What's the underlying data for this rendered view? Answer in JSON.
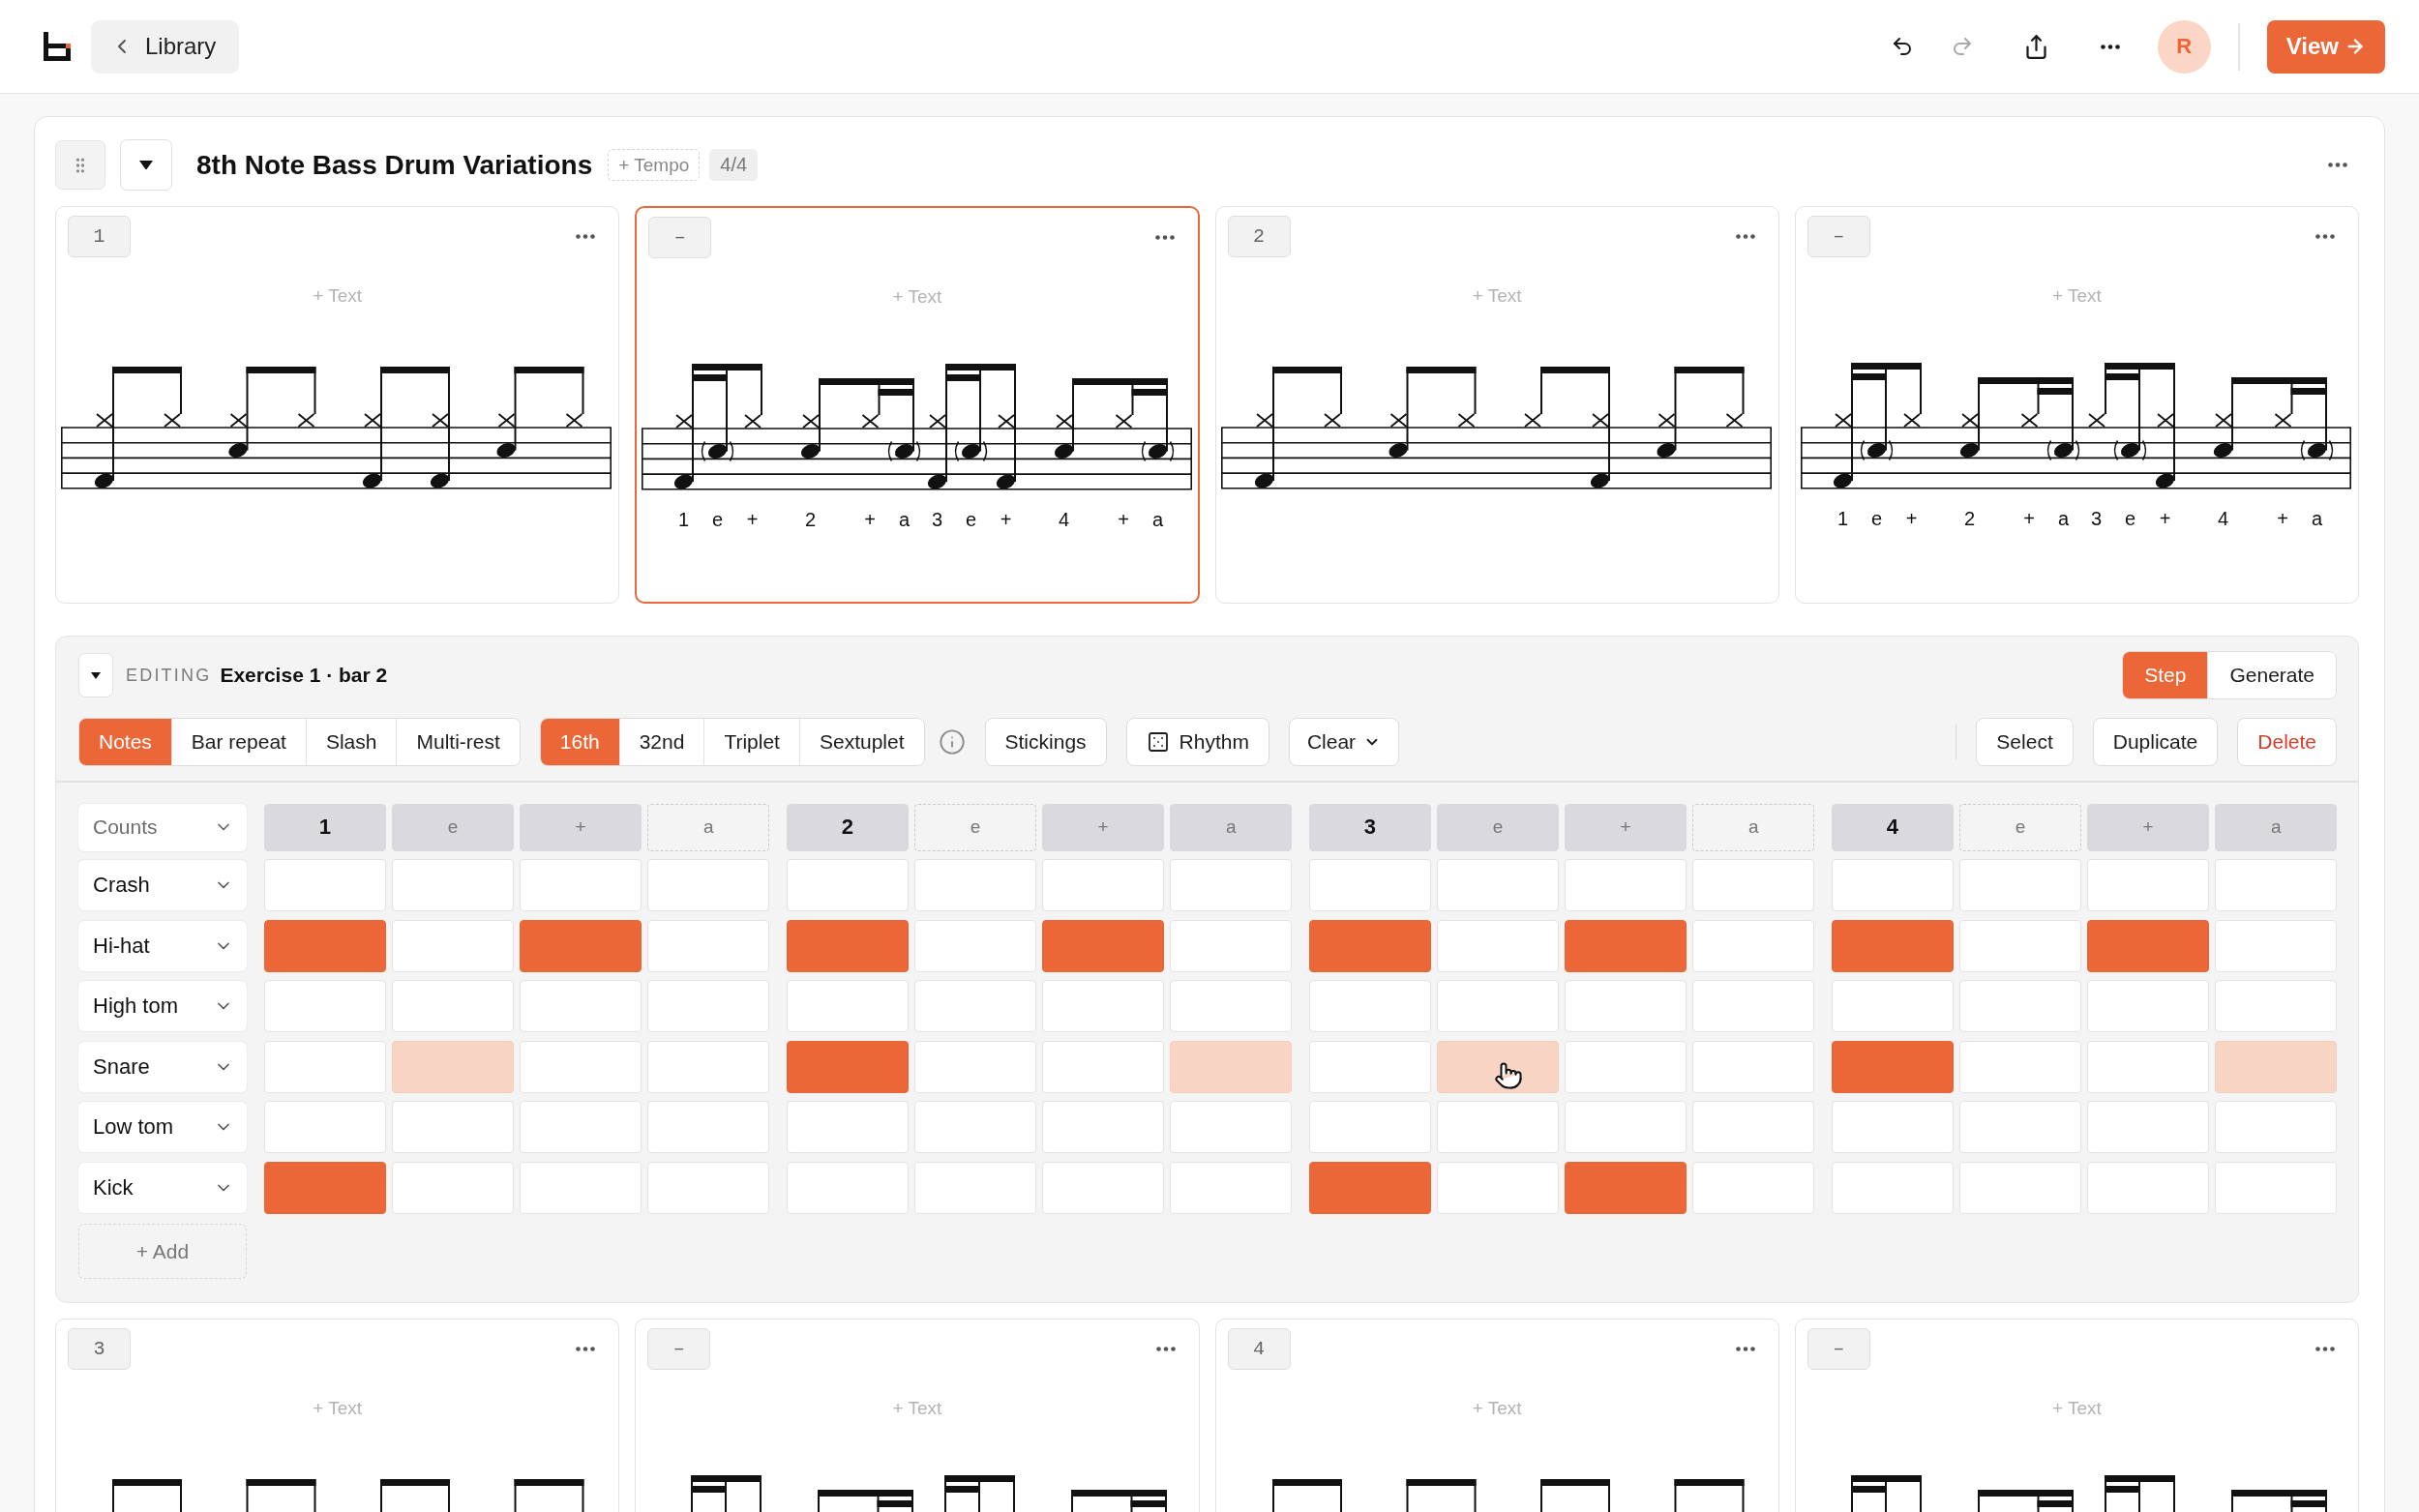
{
  "top_bar": {
    "back_button": {
      "label": "Library"
    },
    "undo": {
      "disabled": false
    },
    "redo": {
      "disabled": true
    },
    "avatar": {
      "initial": "R"
    },
    "view_button": {
      "label": "View"
    }
  },
  "exercise": {
    "title": "8th Note Bass Drum Variations",
    "tempo_button": "+ Tempo",
    "time_signature": "4/4",
    "bars": [
      {
        "number": "1",
        "selected": false,
        "kind": "eighths",
        "add_text": "+ Text"
      },
      {
        "number": "–",
        "selected": true,
        "kind": "sixteenths",
        "add_text": "+ Text",
        "counts": [
          "1",
          "e",
          "+",
          "2",
          "+",
          "a",
          "3",
          "e",
          "+",
          "4",
          "+",
          "a"
        ]
      },
      {
        "number": "2",
        "selected": false,
        "kind": "eighths",
        "add_text": "+ Text"
      },
      {
        "number": "–",
        "selected": false,
        "kind": "sixteenths",
        "add_text": "+ Text",
        "counts": [
          "1",
          "e",
          "+",
          "2",
          "+",
          "a",
          "3",
          "e",
          "+",
          "4",
          "+",
          "a"
        ]
      }
    ],
    "editor": {
      "label": "EDITING",
      "target": "Exercise 1 · bar 2",
      "modes": [
        {
          "label": "Step",
          "selected": true
        },
        {
          "label": "Generate",
          "selected": false
        }
      ],
      "note_types": [
        {
          "label": "Notes",
          "selected": true
        },
        {
          "label": "Bar repeat",
          "selected": false
        },
        {
          "label": "Slash",
          "selected": false
        },
        {
          "label": "Multi-rest",
          "selected": false
        }
      ],
      "subdivisions": [
        {
          "label": "16th",
          "selected": true
        },
        {
          "label": "32nd",
          "selected": false
        },
        {
          "label": "Triplet",
          "selected": false
        },
        {
          "label": "Sextuplet",
          "selected": false
        }
      ],
      "tools": [
        {
          "label": "Stickings",
          "kind": "plain"
        },
        {
          "label": "Rhythm",
          "kind": "dice"
        },
        {
          "label": "Clear",
          "kind": "menu"
        }
      ],
      "actions": [
        {
          "label": "Select",
          "kind": "plain"
        },
        {
          "label": "Duplicate",
          "kind": "plain"
        },
        {
          "label": "Delete",
          "kind": "danger"
        }
      ],
      "counts_select": "Counts",
      "counts": [
        {
          "label": "1",
          "kind": "beat",
          "active": true
        },
        {
          "label": "e",
          "kind": "sub",
          "active": true
        },
        {
          "label": "+",
          "kind": "sub",
          "active": true
        },
        {
          "label": "a",
          "kind": "sub",
          "active": false
        },
        {
          "label": "2",
          "kind": "beat",
          "active": true
        },
        {
          "label": "e",
          "kind": "sub",
          "active": false
        },
        {
          "label": "+",
          "kind": "sub",
          "active": true
        },
        {
          "label": "a",
          "kind": "sub",
          "active": true
        },
        {
          "label": "3",
          "kind": "beat",
          "active": true
        },
        {
          "label": "e",
          "kind": "sub",
          "active": true
        },
        {
          "label": "+",
          "kind": "sub",
          "active": true
        },
        {
          "label": "a",
          "kind": "sub",
          "active": false
        },
        {
          "label": "4",
          "kind": "beat",
          "active": true
        },
        {
          "label": "e",
          "kind": "sub",
          "active": false
        },
        {
          "label": "+",
          "kind": "sub",
          "active": true
        },
        {
          "label": "a",
          "kind": "sub",
          "active": true
        }
      ],
      "rows": [
        {
          "instrument": "Crash",
          "cells": [
            {
              "kind": "empty",
              "hovered": false
            },
            {
              "kind": "empty",
              "hovered": false
            },
            {
              "kind": "empty",
              "hovered": false
            },
            {
              "kind": "empty",
              "hovered": false
            },
            {
              "kind": "empty",
              "hovered": false
            },
            {
              "kind": "empty",
              "hovered": false
            },
            {
              "kind": "empty",
              "hovered": false
            },
            {
              "kind": "empty",
              "hovered": false
            },
            {
              "kind": "empty",
              "hovered": false
            },
            {
              "kind": "empty",
              "hovered": false
            },
            {
              "kind": "empty",
              "hovered": false
            },
            {
              "kind": "empty",
              "hovered": false
            },
            {
              "kind": "empty",
              "hovered": false
            },
            {
              "kind": "empty",
              "hovered": false
            },
            {
              "kind": "empty",
              "hovered": false
            },
            {
              "kind": "empty",
              "hovered": false
            }
          ]
        },
        {
          "instrument": "Hi-hat",
          "cells": [
            {
              "kind": "hit",
              "hovered": false
            },
            {
              "kind": "empty",
              "hovered": false
            },
            {
              "kind": "hit",
              "hovered": false
            },
            {
              "kind": "empty",
              "hovered": false
            },
            {
              "kind": "hit",
              "hovered": false
            },
            {
              "kind": "empty",
              "hovered": false
            },
            {
              "kind": "hit",
              "hovered": false
            },
            {
              "kind": "empty",
              "hovered": false
            },
            {
              "kind": "hit",
              "hovered": false
            },
            {
              "kind": "empty",
              "hovered": false
            },
            {
              "kind": "hit",
              "hovered": false
            },
            {
              "kind": "empty",
              "hovered": false
            },
            {
              "kind": "hit",
              "hovered": false
            },
            {
              "kind": "empty",
              "hovered": false
            },
            {
              "kind": "hit",
              "hovered": false
            },
            {
              "kind": "empty",
              "hovered": false
            }
          ]
        },
        {
          "instrument": "High tom",
          "cells": [
            {
              "kind": "empty",
              "hovered": false
            },
            {
              "kind": "empty",
              "hovered": false
            },
            {
              "kind": "empty",
              "hovered": false
            },
            {
              "kind": "empty",
              "hovered": false
            },
            {
              "kind": "empty",
              "hovered": false
            },
            {
              "kind": "empty",
              "hovered": false
            },
            {
              "kind": "empty",
              "hovered": false
            },
            {
              "kind": "empty",
              "hovered": false
            },
            {
              "kind": "empty",
              "hovered": false
            },
            {
              "kind": "empty",
              "hovered": false
            },
            {
              "kind": "empty",
              "hovered": false
            },
            {
              "kind": "empty",
              "hovered": false
            },
            {
              "kind": "empty",
              "hovered": false
            },
            {
              "kind": "empty",
              "hovered": false
            },
            {
              "kind": "empty",
              "hovered": false
            },
            {
              "kind": "empty",
              "hovered": false
            }
          ]
        },
        {
          "instrument": "Snare",
          "cells": [
            {
              "kind": "empty",
              "hovered": false
            },
            {
              "kind": "ghost",
              "hovered": false
            },
            {
              "kind": "empty",
              "hovered": false
            },
            {
              "kind": "empty",
              "hovered": false
            },
            {
              "kind": "hit",
              "hovered": false
            },
            {
              "kind": "empty",
              "hovered": false
            },
            {
              "kind": "empty",
              "hovered": false
            },
            {
              "kind": "ghost",
              "hovered": false
            },
            {
              "kind": "empty",
              "hovered": false
            },
            {
              "kind": "ghost",
              "hovered": true
            },
            {
              "kind": "empty",
              "hovered": false
            },
            {
              "kind": "empty",
              "hovered": false
            },
            {
              "kind": "hit",
              "hovered": false
            },
            {
              "kind": "empty",
              "hovered": false
            },
            {
              "kind": "empty",
              "hovered": false
            },
            {
              "kind": "ghost",
              "hovered": false
            }
          ]
        },
        {
          "instrument": "Low tom",
          "cells": [
            {
              "kind": "empty",
              "hovered": false
            },
            {
              "kind": "empty",
              "hovered": false
            },
            {
              "kind": "empty",
              "hovered": false
            },
            {
              "kind": "empty",
              "hovered": false
            },
            {
              "kind": "empty",
              "hovered": false
            },
            {
              "kind": "empty",
              "hovered": false
            },
            {
              "kind": "empty",
              "hovered": false
            },
            {
              "kind": "empty",
              "hovered": false
            },
            {
              "kind": "empty",
              "hovered": false
            },
            {
              "kind": "empty",
              "hovered": false
            },
            {
              "kind": "empty",
              "hovered": false
            },
            {
              "kind": "empty",
              "hovered": false
            },
            {
              "kind": "empty",
              "hovered": false
            },
            {
              "kind": "empty",
              "hovered": false
            },
            {
              "kind": "empty",
              "hovered": false
            },
            {
              "kind": "empty",
              "hovered": false
            }
          ]
        },
        {
          "instrument": "Kick",
          "cells": [
            {
              "kind": "hit",
              "hovered": false
            },
            {
              "kind": "empty",
              "hovered": false
            },
            {
              "kind": "empty",
              "hovered": false
            },
            {
              "kind": "empty",
              "hovered": false
            },
            {
              "kind": "empty",
              "hovered": false
            },
            {
              "kind": "empty",
              "hovered": false
            },
            {
              "kind": "empty",
              "hovered": false
            },
            {
              "kind": "empty",
              "hovered": false
            },
            {
              "kind": "hit",
              "hovered": false
            },
            {
              "kind": "empty",
              "hovered": false
            },
            {
              "kind": "hit",
              "hovered": false
            },
            {
              "kind": "empty",
              "hovered": false
            },
            {
              "kind": "empty",
              "hovered": false
            },
            {
              "kind": "empty",
              "hovered": false
            },
            {
              "kind": "empty",
              "hovered": false
            },
            {
              "kind": "empty",
              "hovered": false
            }
          ]
        }
      ],
      "add_button": "+ Add"
    },
    "more_bars": [
      {
        "number": "3",
        "selected": false,
        "kind": "eighths",
        "add_text": "+ Text"
      },
      {
        "number": "–",
        "selected": false,
        "kind": "sixteenths",
        "add_text": "+ Text"
      },
      {
        "number": "4",
        "selected": false,
        "kind": "eighths",
        "add_text": "+ Text"
      },
      {
        "number": "–",
        "selected": false,
        "kind": "sixteenths",
        "add_text": "+ Text"
      }
    ]
  }
}
